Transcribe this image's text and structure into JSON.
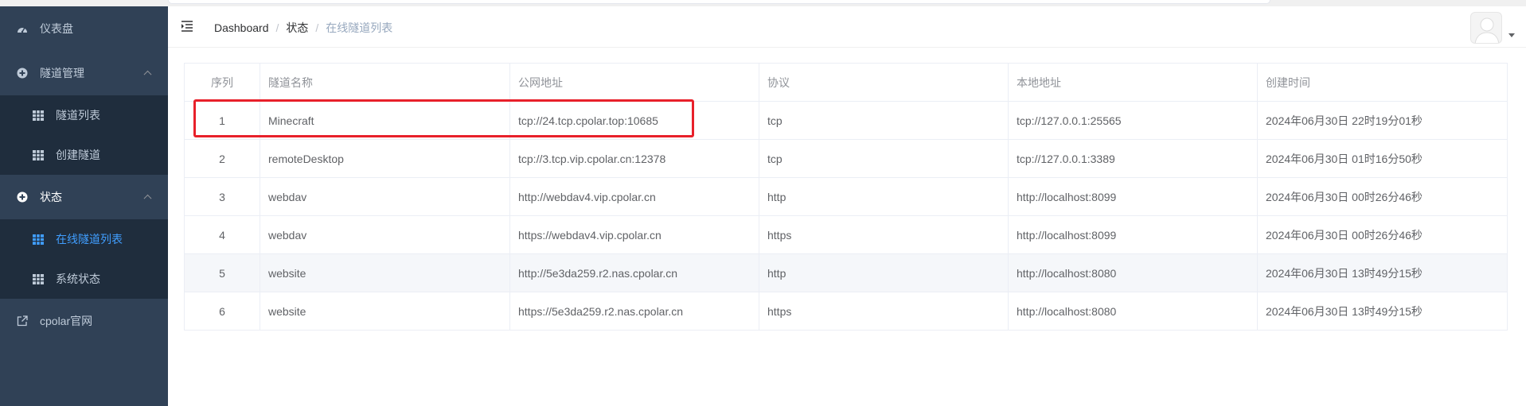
{
  "sidebar": {
    "items": [
      {
        "label": "仪表盘",
        "icon": "dashboard-icon"
      },
      {
        "label": "隧道管理",
        "icon": "tunnel-manage-icon"
      },
      {
        "label": "隧道列表",
        "icon": "grid-icon"
      },
      {
        "label": "创建隧道",
        "icon": "grid-icon"
      },
      {
        "label": "状态",
        "icon": "status-icon"
      },
      {
        "label": "在线隧道列表",
        "icon": "grid-icon"
      },
      {
        "label": "系统状态",
        "icon": "grid-icon"
      },
      {
        "label": "cpolar官网",
        "icon": "external-link-icon"
      }
    ]
  },
  "breadcrumb": {
    "home": "Dashboard",
    "status": "状态",
    "current": "在线隧道列表"
  },
  "table": {
    "headers": [
      "序列",
      "隧道名称",
      "公网地址",
      "协议",
      "本地地址",
      "创建时间"
    ],
    "rows": [
      [
        "1",
        "Minecraft",
        "tcp://24.tcp.cpolar.top:10685",
        "tcp",
        "tcp://127.0.0.1:25565",
        "2024年06月30日 22时19分01秒"
      ],
      [
        "2",
        "remoteDesktop",
        "tcp://3.tcp.vip.cpolar.cn:12378",
        "tcp",
        "tcp://127.0.0.1:3389",
        "2024年06月30日 01时16分50秒"
      ],
      [
        "3",
        "webdav",
        "http://webdav4.vip.cpolar.cn",
        "http",
        "http://localhost:8099",
        "2024年06月30日 00时26分46秒"
      ],
      [
        "4",
        "webdav",
        "https://webdav4.vip.cpolar.cn",
        "https",
        "http://localhost:8099",
        "2024年06月30日 00时26分46秒"
      ],
      [
        "5",
        "website",
        "http://5e3da259.r2.nas.cpolar.cn",
        "http",
        "http://localhost:8080",
        "2024年06月30日 13时49分15秒"
      ],
      [
        "6",
        "website",
        "https://5e3da259.r2.nas.cpolar.cn",
        "https",
        "http://localhost:8080",
        "2024年06月30日 13时49分15秒"
      ]
    ]
  },
  "colors": {
    "sidebar_bg": "#304156",
    "submenu_bg": "#1f2d3d",
    "active": "#409eff",
    "highlight_box": "#e8202a"
  }
}
